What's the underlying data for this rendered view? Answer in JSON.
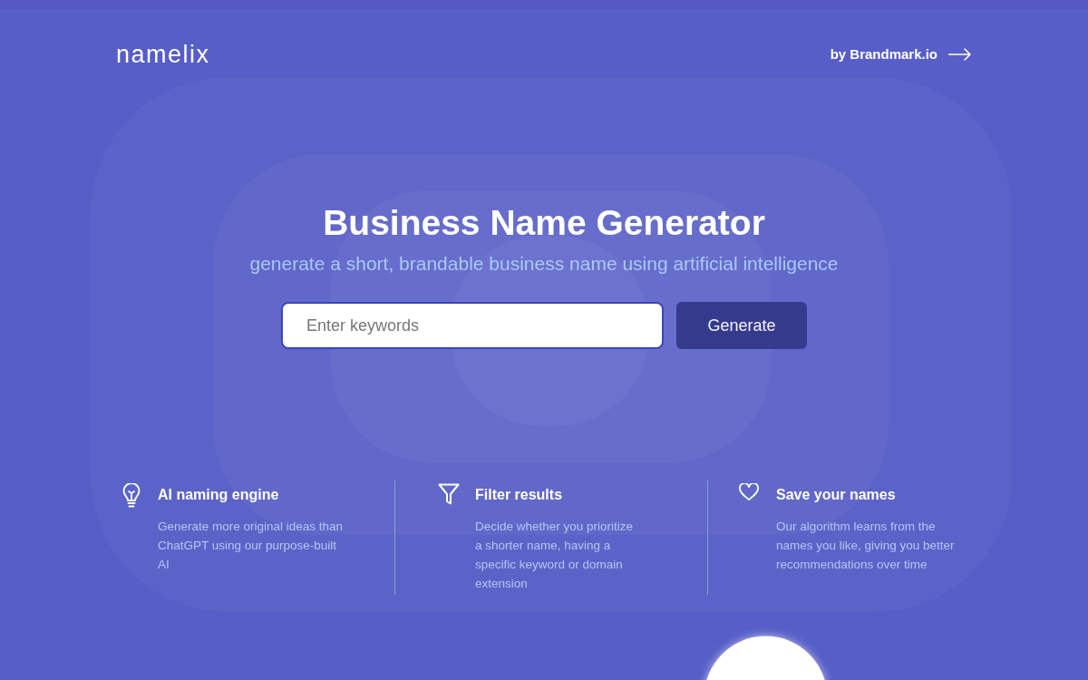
{
  "header": {
    "logo": "namelix",
    "link": "by Brandmark.io"
  },
  "hero": {
    "title": "Business Name Generator",
    "subtitle": "generate a short, brandable business name using artificial intelligence",
    "search": {
      "placeholder": "Enter keywords"
    },
    "button": "Generate"
  },
  "features": [
    {
      "title": "AI naming engine",
      "description": "Generate more original ideas than ChatGPT using our purpose-built AI"
    },
    {
      "title": "Filter results",
      "description": "Decide whether you prioritize a shorter name, having a specific keyword or domain extension"
    },
    {
      "title": "Save your names",
      "description": "Our algorithm learns from the names you like, giving you better recommendations over time"
    }
  ]
}
